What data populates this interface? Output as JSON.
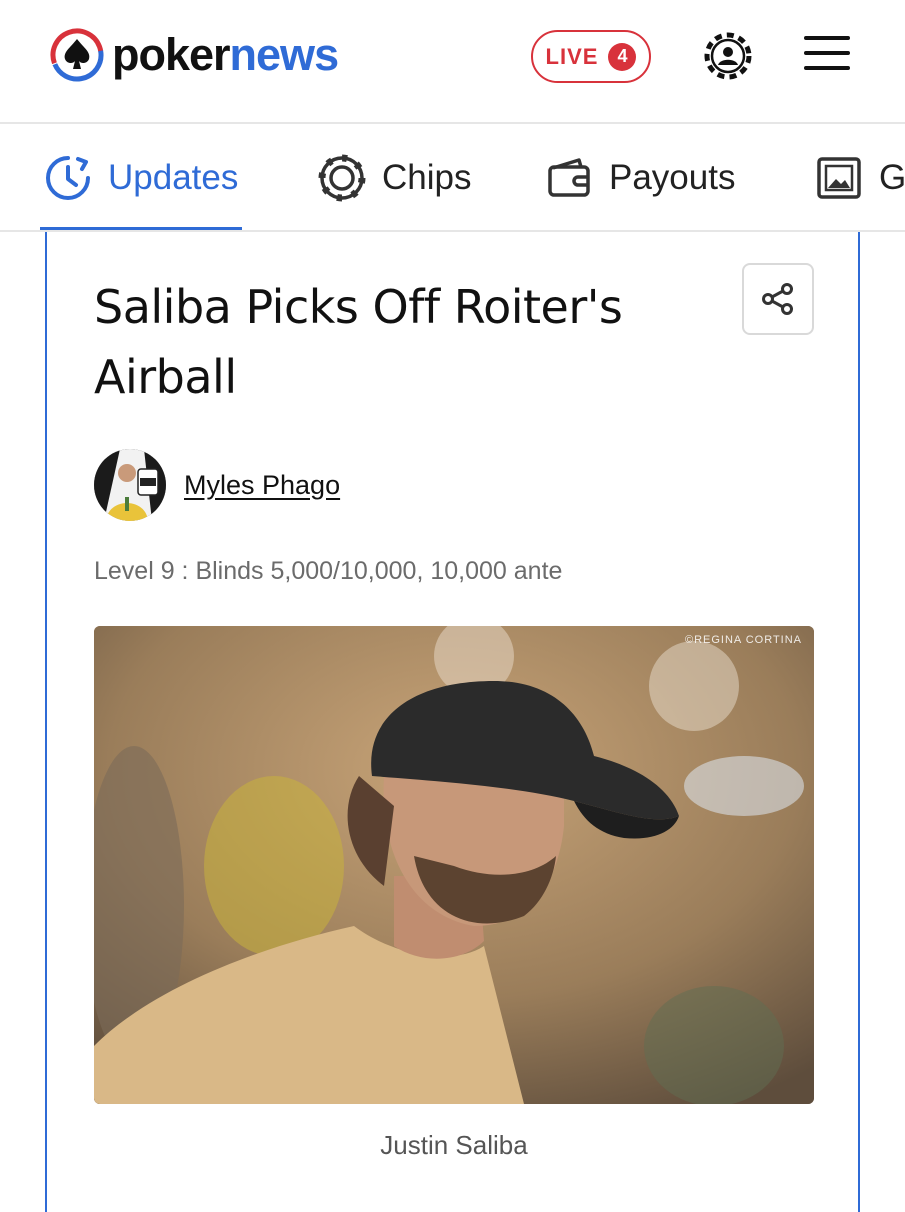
{
  "header": {
    "logo_part1": "poker",
    "logo_part2": "news",
    "live_label": "LIVE",
    "live_count": "4",
    "user_icon": "user-chip-icon",
    "menu_icon": "hamburger-menu-icon"
  },
  "tabs": [
    {
      "label": "Updates",
      "icon": "clock-icon",
      "active": true
    },
    {
      "label": "Chips",
      "icon": "poker-chip-icon",
      "active": false
    },
    {
      "label": "Payouts",
      "icon": "wallet-icon",
      "active": false
    },
    {
      "label": "G",
      "icon": "gallery-icon",
      "active": false
    }
  ],
  "post": {
    "title": "Saliba Picks Off Roiter's Airball",
    "share_icon": "share-icon",
    "author": "Myles Phago",
    "level_info": "Level 9 : Blinds 5,000/10,000, 10,000 ante",
    "photo_credit": "©REGINA CORTINA",
    "photo_caption": "Justin Saliba"
  },
  "colors": {
    "brand_blue": "#2f6bd6",
    "live_red": "#d8323b",
    "muted_text": "#6b6b6b"
  }
}
